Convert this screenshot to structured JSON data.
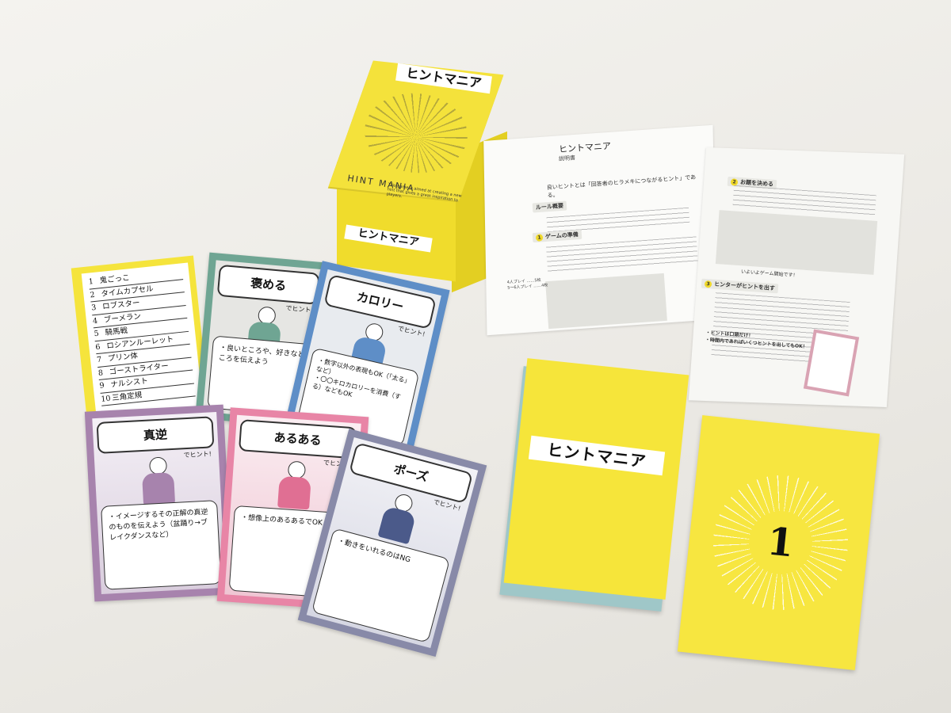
{
  "box": {
    "title": "ヒントマニア",
    "brand": "HINT MANIA",
    "description": "This game is aimed at creating a new hint that gives a great inspiration to players.",
    "side_title": "ヒントマニア"
  },
  "instructions": {
    "title": "ヒントマニア",
    "subtitle": "説明書",
    "lead": "良いヒントとは「回答者のヒラメキにつながるヒント」である。",
    "sections": [
      {
        "num": "",
        "label": "ルール概要"
      },
      {
        "num": "1",
        "label": "ゲームの準備"
      },
      {
        "num": "2",
        "label": "お題を決める"
      },
      {
        "num": "3",
        "label": "ヒンターがヒントを出す"
      }
    ],
    "note": "4人プレイ ……5枚\n5〜6人プレイ ……4枚",
    "callout": "いよいよゲーム開始です！",
    "bullets": [
      "・ヒントは口頭だけ！",
      "・時間内であればいくつヒントを出してもOK！"
    ]
  },
  "deck": {
    "title": "ヒントマニア"
  },
  "number_card": {
    "value": "1"
  },
  "topic_list": {
    "items": [
      {
        "n": "1",
        "text": "鬼ごっこ"
      },
      {
        "n": "2",
        "text": "タイムカプセル"
      },
      {
        "n": "3",
        "text": "ロブスター"
      },
      {
        "n": "4",
        "text": "ブーメラン"
      },
      {
        "n": "5",
        "text": "騎馬戦"
      },
      {
        "n": "6",
        "text": "ロシアンルーレット"
      },
      {
        "n": "7",
        "text": "プリン体"
      },
      {
        "n": "8",
        "text": "ゴーストライター"
      },
      {
        "n": "9",
        "text": "ナルシスト"
      },
      {
        "n": "10",
        "text": "三角定規"
      }
    ]
  },
  "hint_cards": {
    "homeru": {
      "title": "褒める",
      "tag": "でヒント!",
      "desc": "・良いところや、好きなところを伝えよう",
      "color": "#6fa593"
    },
    "calorie": {
      "title": "カロリー",
      "tag": "でヒント!",
      "desc": "・数字以外の表現もOK（「太る」など）\n・〇〇キロカロリーを消費（する）などもOK",
      "color": "#5e8ec7"
    },
    "gyaku": {
      "title": "真逆",
      "tag": "でヒント!",
      "desc": "・イメージするその正解の真逆のものを伝えよう（盆踊り→ブレイクダンスなど）",
      "color": "#a783ad"
    },
    "aruaru": {
      "title": "あるある",
      "tag": "でヒント!",
      "desc": "・想像上のあるあるでOK",
      "color": "#e885a6"
    },
    "pose": {
      "title": "ポーズ",
      "tag": "でヒント!",
      "desc": "・動きをいれるのはNG",
      "color": "#888aa8"
    }
  }
}
